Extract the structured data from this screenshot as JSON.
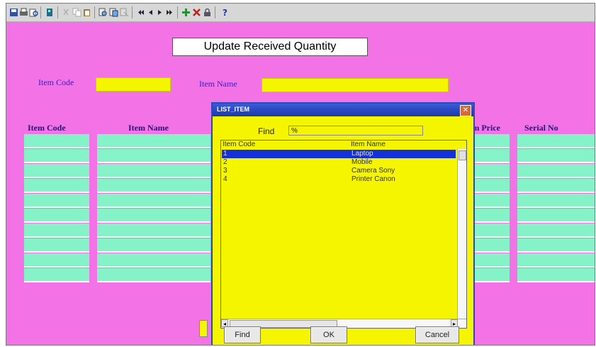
{
  "toolbar": {
    "icons": [
      "save-icon",
      "print-icon",
      "print-preview-icon",
      "exit-icon",
      "cut-icon",
      "copy-icon",
      "paste-icon",
      "find-icon",
      "find-next-icon",
      "clear-icon",
      "first-record-icon",
      "prev-record-icon",
      "next-record-icon",
      "last-record-icon",
      "insert-record-icon",
      "delete-record-icon",
      "lock-record-icon",
      "help-icon"
    ]
  },
  "form": {
    "title": "Update Received Quantity",
    "item_code_label": "Item Code",
    "item_name_label": "Item Name",
    "columns": [
      "Item Code",
      "Item Name",
      "em Price",
      "Serial No"
    ]
  },
  "dialog": {
    "title": "LIST_ITEM",
    "find_label": "Find",
    "find_value": "%",
    "col_code": "Item Code",
    "col_name": "Item Name",
    "rows": [
      {
        "code": "1",
        "name": "Laptop"
      },
      {
        "code": "2",
        "name": "Mobile"
      },
      {
        "code": "3",
        "name": "Camera Sony"
      },
      {
        "code": "4",
        "name": "Printer Canon"
      }
    ],
    "find_button": "Find",
    "ok_button": "OK",
    "cancel_button": "Cancel"
  },
  "colors": {
    "background": "#f372e6",
    "field_yellow": "#f5f500",
    "grid_cell": "#85f2c8",
    "selected_row": "#1430d8"
  }
}
